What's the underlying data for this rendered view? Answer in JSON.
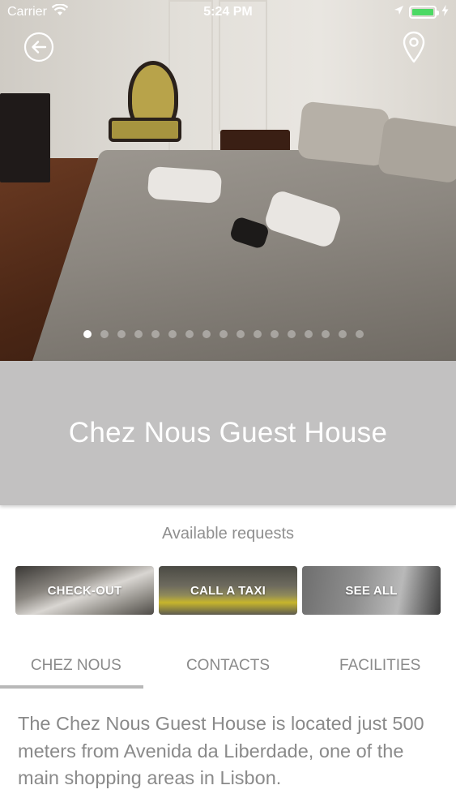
{
  "status_bar": {
    "carrier": "Carrier",
    "time": "5:24 PM",
    "battery_level": 1.0,
    "battery_color": "#4cd964"
  },
  "hero": {
    "back_icon": "arrow-left-circle-icon",
    "location_icon": "map-pin-icon",
    "pager": {
      "count": 17,
      "active_index": 0
    }
  },
  "title": "Chez Nous Guest House",
  "requests": {
    "label": "Available requests",
    "items": [
      {
        "label": "CHECK-OUT"
      },
      {
        "label": "CALL A TAXI"
      },
      {
        "label": "SEE ALL"
      }
    ]
  },
  "tabs": [
    {
      "label": "CHEZ NOUS",
      "active": true
    },
    {
      "label": "CONTACTS",
      "active": false
    },
    {
      "label": "FACILITIES",
      "active": false
    }
  ],
  "description": "The Chez Nous Guest House is located just 500 meters from Avenida da Liberdade, one of the main shopping areas in Lisbon.",
  "colors": {
    "title_band": "#c2c1c1",
    "muted_text": "#8a8a8a",
    "tab_indicator": "#b8b8b8"
  }
}
